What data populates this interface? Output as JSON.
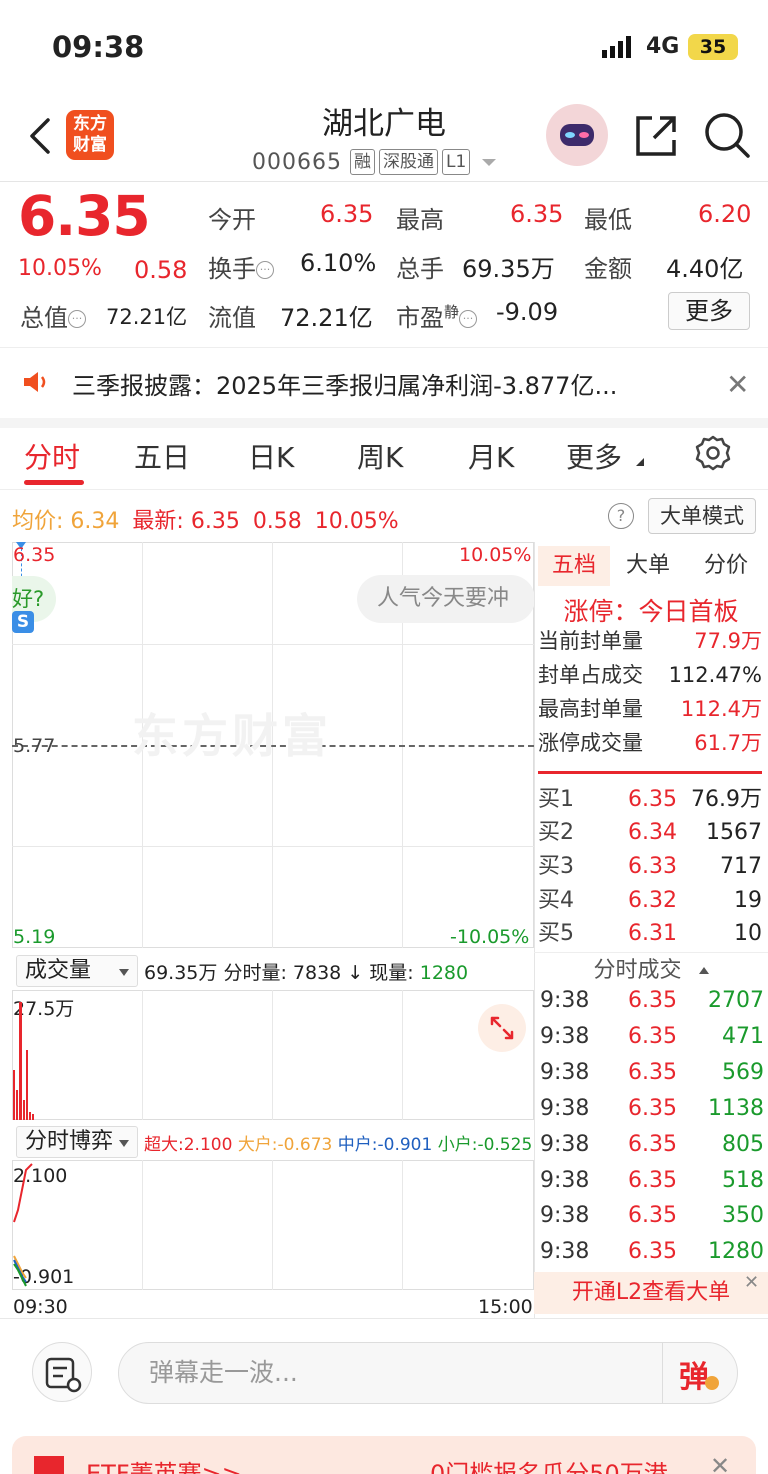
{
  "status": {
    "time": "09:38",
    "network": "4G",
    "battery": "35"
  },
  "header": {
    "title": "湖北广电",
    "code": "000665",
    "tags": [
      "融",
      "深股通",
      "L1"
    ],
    "logo_text": "东方财富"
  },
  "quote": {
    "price": "6.35",
    "pct": "10.05%",
    "change": "0.58",
    "open_label": "今开",
    "open": "6.35",
    "high_label": "最高",
    "high": "6.35",
    "low_label": "最低",
    "low": "6.20",
    "turnover_label": "换手",
    "turnover": "6.10%",
    "volume_label": "总手",
    "volume": "69.35万",
    "amount_label": "金额",
    "amount": "4.40亿",
    "mcap_label": "总值",
    "mcap": "72.21亿",
    "float_label": "流值",
    "float": "72.21亿",
    "pe_label": "市盈",
    "pe_sup": "静",
    "pe": "-9.09",
    "more": "更多"
  },
  "notice": {
    "text": "三季报披露：2025年三季报归属净利润-3.877亿..."
  },
  "tabs": [
    "分时",
    "五日",
    "日K",
    "周K",
    "月K",
    "更多"
  ],
  "chart_head": {
    "avg_label": "均价:",
    "avg": "6.34",
    "latest_label": "最新:",
    "latest": "6.35",
    "chg": "0.58",
    "pct": "10.05%",
    "mode": "大单模式"
  },
  "chart": {
    "top_price": "6.35",
    "top_pct": "10.05%",
    "mid_price": "5.77",
    "bottom_price": "5.19",
    "bottom_pct": "-10.05%",
    "watermark": "东方财富",
    "bubble": "人气今天要冲",
    "bubble_left": "好?",
    "s_badge": "S",
    "time_start": "09:30",
    "time_end": "15:00"
  },
  "right_tabs": [
    "五档",
    "大单",
    "分价"
  ],
  "limit": {
    "title": "涨停：今日首板",
    "rows": [
      {
        "k": "当前封单量",
        "v": "77.9万",
        "color": "#e8262d"
      },
      {
        "k": "封单占成交",
        "v": "112.47%",
        "color": "#222222"
      },
      {
        "k": "最高封单量",
        "v": "112.4万",
        "color": "#e8262d"
      },
      {
        "k": "涨停成交量",
        "v": "61.7万",
        "color": "#e8262d"
      }
    ]
  },
  "book": [
    {
      "label": "买1",
      "price": "6.35",
      "vol": "76.9万"
    },
    {
      "label": "买2",
      "price": "6.34",
      "vol": "1567"
    },
    {
      "label": "买3",
      "price": "6.33",
      "vol": "717"
    },
    {
      "label": "买4",
      "price": "6.32",
      "vol": "19"
    },
    {
      "label": "买5",
      "price": "6.31",
      "vol": "10"
    }
  ],
  "ticks_title": "分时成交",
  "ticks": [
    {
      "t": "9:38",
      "p": "6.35",
      "v": "2707"
    },
    {
      "t": "9:38",
      "p": "6.35",
      "v": "471"
    },
    {
      "t": "9:38",
      "p": "6.35",
      "v": "569"
    },
    {
      "t": "9:38",
      "p": "6.35",
      "v": "1138"
    },
    {
      "t": "9:38",
      "p": "6.35",
      "v": "805"
    },
    {
      "t": "9:38",
      "p": "6.35",
      "v": "518"
    },
    {
      "t": "9:38",
      "p": "6.35",
      "v": "350"
    },
    {
      "t": "9:38",
      "p": "6.35",
      "v": "1280"
    }
  ],
  "l2": "开通L2查看大单",
  "volume": {
    "dropdown": "成交量",
    "total": "69.35万",
    "tick_label": "分时量:",
    "tick": "7838",
    "arrow": "↓",
    "now_label": "现量:",
    "now": "1280",
    "max_label": "27.5万"
  },
  "game": {
    "dropdown": "分时博弈",
    "super_label": "超大:",
    "super": "2.100",
    "big_label": "大户:",
    "big": "-0.673",
    "mid_label": "中户:",
    "mid": "-0.901",
    "small_label": "小户:",
    "small": "-0.525",
    "top_label": "2.100",
    "bottom_label": "-0.901"
  },
  "bullet": {
    "placeholder": "弹幕走一波...",
    "btn": "弹"
  },
  "promo": {
    "left": "ETF菁英赛>>",
    "right": "0门槛报名瓜分50万港"
  },
  "colors": {
    "up": "#e8262d",
    "down": "#1a9a2c",
    "avg": "#f0a43a",
    "accent": "#f04f1f"
  }
}
